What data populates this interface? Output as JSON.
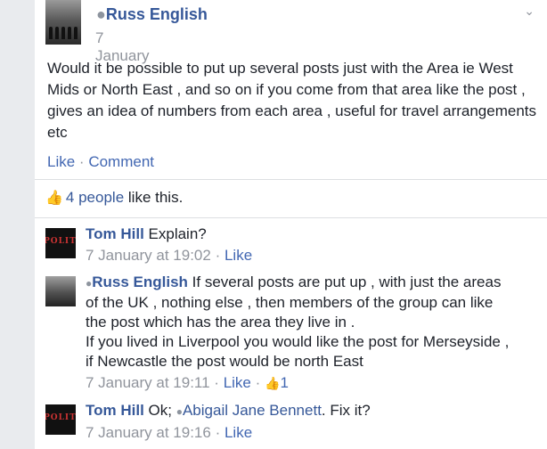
{
  "post": {
    "author": "Russ English",
    "date": "7 January",
    "text": "Would it be possible to put up several posts just with the Area ie West Mids or North East , and so on if you come from that area like the post , gives an idea of numbers from each area , useful for travel arrangements etc",
    "actions": {
      "like": "Like",
      "separator": "·",
      "comment": "Comment"
    }
  },
  "likes": {
    "count_text": "4 people",
    "suffix": "like this."
  },
  "comments": [
    {
      "author": "Tom Hill",
      "text": "Explain?",
      "time": "7 January at 19:02",
      "like": "Like",
      "avatar": "POLITICS"
    },
    {
      "author": "Russ English",
      "text": "If several posts are put up , with just the areas of the UK , nothing else , then members of the group can like the post which has the area they live in .",
      "text2": "If you lived in Liverpool you would like the post for Merseyside , if Newcastle the post would be north East",
      "time": "7 January at 19:11",
      "like": "Like",
      "like_count": "1"
    },
    {
      "author": "Tom Hill",
      "text_before": "Ok;",
      "mention": "Abigail Jane Bennett",
      "text_after": ". Fix it?",
      "time": "7 January at 19:16",
      "like": "Like",
      "avatar": "POLITICS"
    }
  ],
  "icons": {
    "gray_dot": "gray-dot-icon",
    "thumb": "thumbs-up-icon",
    "chevron": "chevron-down-icon"
  },
  "colors": {
    "link": "#365899",
    "action": "#4267b2",
    "meta": "#90949c",
    "background": "#e9ebee"
  }
}
